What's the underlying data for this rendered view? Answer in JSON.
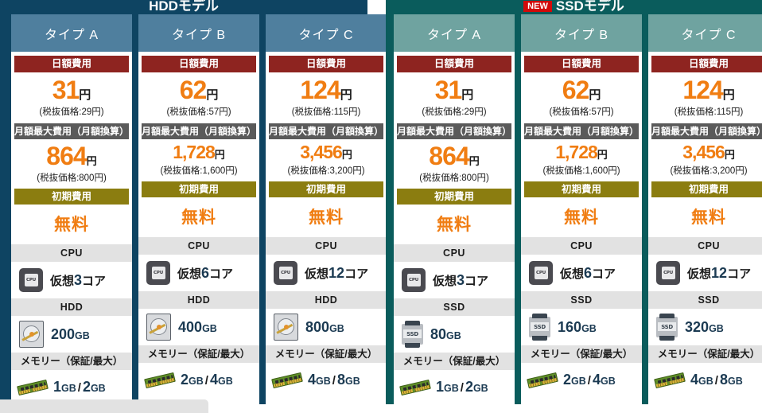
{
  "panels": [
    {
      "id": "hdd-model",
      "title": "HDDモデル",
      "badge": null,
      "accent": "#0e4462",
      "header_bg": "#4f7f9e",
      "storage_label": "HDD",
      "storage_icon": "hdd-icon",
      "columns": [
        {
          "type_label": "タイプ A",
          "daily_label": "日額費用",
          "daily_price": "31",
          "daily_yen": "円",
          "daily_sub": "(税抜価格:29円)",
          "monthly_label": "月額最大費用（月額換算）",
          "monthly_price": "864",
          "monthly_yen": "円",
          "monthly_sub": "(税抜価格:800円)",
          "initial_label": "初期費用",
          "initial_value": "無料",
          "cpu_label": "CPU",
          "cpu_value_pre": "仮想",
          "cpu_value_num": "3",
          "cpu_value_post": "コア",
          "storage_label": "HDD",
          "storage_value": "200",
          "storage_unit": "GB",
          "memory_label": "メモリー（保証/最大）",
          "memory_guaranteed": "1",
          "memory_max": "2",
          "memory_unit": "GB",
          "memory_sep": "/"
        },
        {
          "type_label": "タイプ B",
          "daily_label": "日額費用",
          "daily_price": "62",
          "daily_yen": "円",
          "daily_sub": "(税抜価格:57円)",
          "monthly_label": "月額最大費用（月額換算）",
          "monthly_price": "1,728",
          "monthly_yen": "円",
          "monthly_sub": "(税抜価格:1,600円)",
          "initial_label": "初期費用",
          "initial_value": "無料",
          "cpu_label": "CPU",
          "cpu_value_pre": "仮想",
          "cpu_value_num": "6",
          "cpu_value_post": "コア",
          "storage_label": "HDD",
          "storage_value": "400",
          "storage_unit": "GB",
          "memory_label": "メモリー（保証/最大）",
          "memory_guaranteed": "2",
          "memory_max": "4",
          "memory_unit": "GB",
          "memory_sep": "/"
        },
        {
          "type_label": "タイプ C",
          "daily_label": "日額費用",
          "daily_price": "124",
          "daily_yen": "円",
          "daily_sub": "(税抜価格:115円)",
          "monthly_label": "月額最大費用（月額換算）",
          "monthly_price": "3,456",
          "monthly_yen": "円",
          "monthly_sub": "(税抜価格:3,200円)",
          "initial_label": "初期費用",
          "initial_value": "無料",
          "cpu_label": "CPU",
          "cpu_value_pre": "仮想",
          "cpu_value_num": "12",
          "cpu_value_post": "コア",
          "storage_label": "HDD",
          "storage_value": "800",
          "storage_unit": "GB",
          "memory_label": "メモリー（保証/最大）",
          "memory_guaranteed": "4",
          "memory_max": "8",
          "memory_unit": "GB",
          "memory_sep": "/"
        }
      ]
    },
    {
      "id": "ssd-model",
      "title": "SSDモデル",
      "badge": "NEW",
      "accent": "#0a5c5c",
      "header_bg": "#6fa3a0",
      "storage_label": "SSD",
      "storage_icon": "ssd-icon",
      "columns": [
        {
          "type_label": "タイプ A",
          "daily_label": "日額費用",
          "daily_price": "31",
          "daily_yen": "円",
          "daily_sub": "(税抜価格:29円)",
          "monthly_label": "月額最大費用（月額換算）",
          "monthly_price": "864",
          "monthly_yen": "円",
          "monthly_sub": "(税抜価格:800円)",
          "initial_label": "初期費用",
          "initial_value": "無料",
          "cpu_label": "CPU",
          "cpu_value_pre": "仮想",
          "cpu_value_num": "3",
          "cpu_value_post": "コア",
          "storage_label": "SSD",
          "storage_value": "80",
          "storage_unit": "GB",
          "memory_label": "メモリー（保証/最大）",
          "memory_guaranteed": "1",
          "memory_max": "2",
          "memory_unit": "GB",
          "memory_sep": "/"
        },
        {
          "type_label": "タイプ B",
          "daily_label": "日額費用",
          "daily_price": "62",
          "daily_yen": "円",
          "daily_sub": "(税抜価格:57円)",
          "monthly_label": "月額最大費用（月額換算）",
          "monthly_price": "1,728",
          "monthly_yen": "円",
          "monthly_sub": "(税抜価格:1,600円)",
          "initial_label": "初期費用",
          "initial_value": "無料",
          "cpu_label": "CPU",
          "cpu_value_pre": "仮想",
          "cpu_value_num": "6",
          "cpu_value_post": "コア",
          "storage_label": "SSD",
          "storage_value": "160",
          "storage_unit": "GB",
          "memory_label": "メモリー（保証/最大）",
          "memory_guaranteed": "2",
          "memory_max": "4",
          "memory_unit": "GB",
          "memory_sep": "/"
        },
        {
          "type_label": "タイプ C",
          "daily_label": "日額費用",
          "daily_price": "124",
          "daily_yen": "円",
          "daily_sub": "(税抜価格:115円)",
          "monthly_label": "月額最大費用（月額換算）",
          "monthly_price": "3,456",
          "monthly_yen": "円",
          "monthly_sub": "(税抜価格:3,200円)",
          "initial_label": "初期費用",
          "initial_value": "無料",
          "cpu_label": "CPU",
          "cpu_value_pre": "仮想",
          "cpu_value_num": "12",
          "cpu_value_post": "コア",
          "storage_label": "SSD",
          "storage_value": "320",
          "storage_unit": "GB",
          "memory_label": "メモリー（保証/最大）",
          "memory_guaranteed": "4",
          "memory_max": "8",
          "memory_unit": "GB",
          "memory_sep": "/"
        }
      ]
    }
  ],
  "icons": {
    "cpu": "CPU",
    "ssd": "SSD"
  },
  "colors": {
    "price_orange": "#f07d12",
    "daily_band": "#8e2420",
    "monthly_band": "#5a5a5a",
    "initial_band": "#8b7d10",
    "spec_band": "#e2e2e2",
    "spec_value": "#1b3a52",
    "new_badge": "#d10a0a"
  }
}
